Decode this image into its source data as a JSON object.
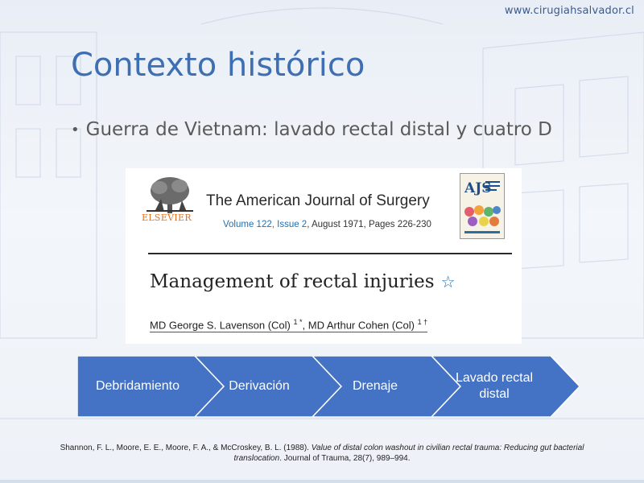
{
  "header": {
    "website": "www.cirugiahsalvador.cl"
  },
  "slide": {
    "title": "Contexto histórico",
    "bullets": [
      "Guerra de Vietnam: lavado rectal distal y cuatro D"
    ]
  },
  "article": {
    "publisher": "ELSEVIER",
    "journal_name": "The American Journal of Surgery",
    "volume_link": "Volume 122, Issue 2",
    "date_pages": ", August 1971, Pages 226-230",
    "cover_label": "AJS",
    "title": "Management of rectal injuries",
    "author1": "MD George S. Lavenson (Col)",
    "author1_marks": "1 *",
    "author_sep": ", ",
    "author2": "MD Arthur Cohen (Col)",
    "author2_marks": "1 †"
  },
  "process": {
    "steps": [
      "Debridamiento",
      "Derivación",
      "Drenaje",
      "Lavado rectal distal"
    ],
    "color": "#4472c4"
  },
  "citation": {
    "authors": "Shannon, F. L., Moore, E. E., Moore, F. A., & McCroskey, B. L. (1988). ",
    "title": "Value of distal colon washout in civilian rectal trauma: Reducing gut bacterial translocation",
    "source": ". Journal of Trauma, 28(7), 989–994."
  }
}
